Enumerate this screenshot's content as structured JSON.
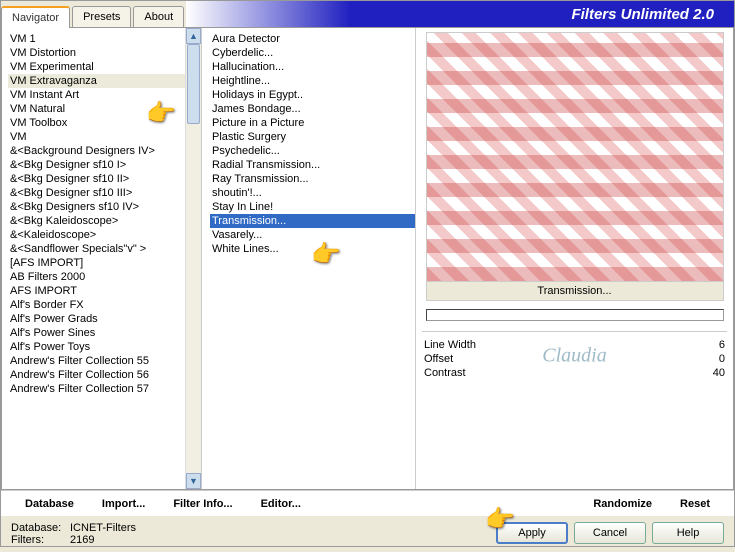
{
  "app": {
    "title": "Filters Unlimited 2.0"
  },
  "tabs": {
    "navigator": "Navigator",
    "presets": "Presets",
    "about": "About"
  },
  "categories": [
    "VM 1",
    "VM Distortion",
    "VM Experimental",
    "VM Extravaganza",
    "VM Instant Art",
    "VM Natural",
    "VM Toolbox",
    "VM",
    "&<Background Designers IV>",
    "&<Bkg Designer sf10 I>",
    "&<Bkg Designer sf10 II>",
    "&<Bkg Designer sf10 III>",
    "&<Bkg Designers sf10 IV>",
    "&<Bkg Kaleidoscope>",
    "&<Kaleidoscope>",
    "&<Sandflower Specials\"v\" >",
    "[AFS IMPORT]",
    "AB Filters 2000",
    "AFS IMPORT",
    "Alf's Border FX",
    "Alf's Power Grads",
    "Alf's Power Sines",
    "Alf's Power Toys",
    "Andrew's Filter Collection 55",
    "Andrew's Filter Collection 56",
    "Andrew's Filter Collection 57"
  ],
  "selected_category_index": 3,
  "filters": [
    "Aura Detector",
    "Cyberdelic...",
    "Hallucination...",
    "Heightline...",
    "Holidays in Egypt..",
    "James Bondage...",
    "Picture in a Picture",
    "Plastic Surgery",
    "Psychedelic...",
    "Radial Transmission...",
    "Ray Transmission...",
    "shoutin'!...",
    "Stay In Line!",
    "Transmission...",
    "Vasarely...",
    "White Lines..."
  ],
  "selected_filter_index": 13,
  "preview_label": "Transmission...",
  "params": [
    {
      "name": "Line Width",
      "value": "6"
    },
    {
      "name": "Offset",
      "value": "0"
    },
    {
      "name": "Contrast",
      "value": "40"
    }
  ],
  "buttons": {
    "database": "Database",
    "import": "Import...",
    "filter_info": "Filter Info...",
    "editor": "Editor...",
    "randomize": "Randomize",
    "reset": "Reset",
    "apply": "Apply",
    "cancel": "Cancel",
    "help": "Help"
  },
  "footer": {
    "db_label": "Database:",
    "db_value": "ICNET-Filters",
    "filters_label": "Filters:",
    "filters_value": "2169"
  },
  "watermark": "Claudia"
}
